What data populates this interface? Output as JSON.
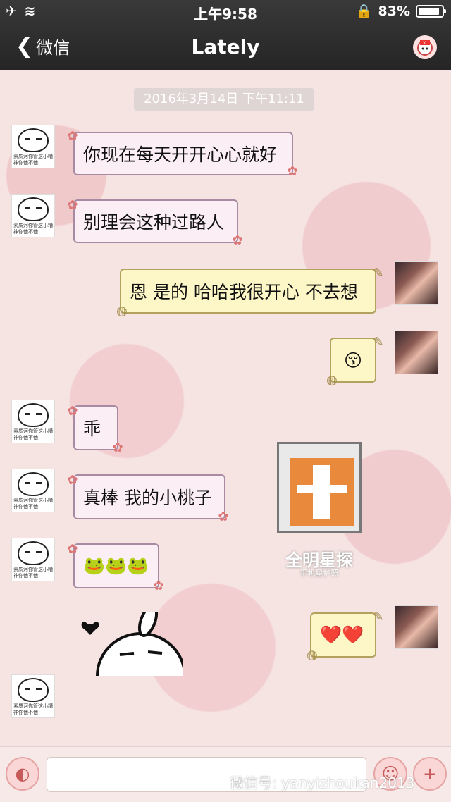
{
  "status": {
    "time": "上午9:58",
    "battery": "83%"
  },
  "nav": {
    "back_label": "微信",
    "title": "Lately"
  },
  "chat": {
    "timestamp": "2016年3月14日 下午11:11",
    "avatar_caption": "素质河你管这小糟神你他不他",
    "messages": [
      {
        "side": "in",
        "text": "你现在每天开开心心就好"
      },
      {
        "side": "in",
        "text": "别理会这种过路人"
      },
      {
        "side": "out",
        "text": "恩 是的 哈哈我很开心 不去想"
      },
      {
        "side": "out",
        "text": "😚"
      },
      {
        "side": "in",
        "text": "乖"
      },
      {
        "side": "in",
        "text": "真棒 我的小桃子"
      },
      {
        "side": "in",
        "text": "🐸🐸🐸"
      },
      {
        "side": "out",
        "text": "❤️❤️"
      },
      {
        "side": "in",
        "text": "sticker"
      }
    ]
  },
  "watermark": {
    "title": "全明星探",
    "subtitle": "手机星护照"
  },
  "footer": {
    "wechat_account": "微信号: yanyizhoukan2013"
  }
}
